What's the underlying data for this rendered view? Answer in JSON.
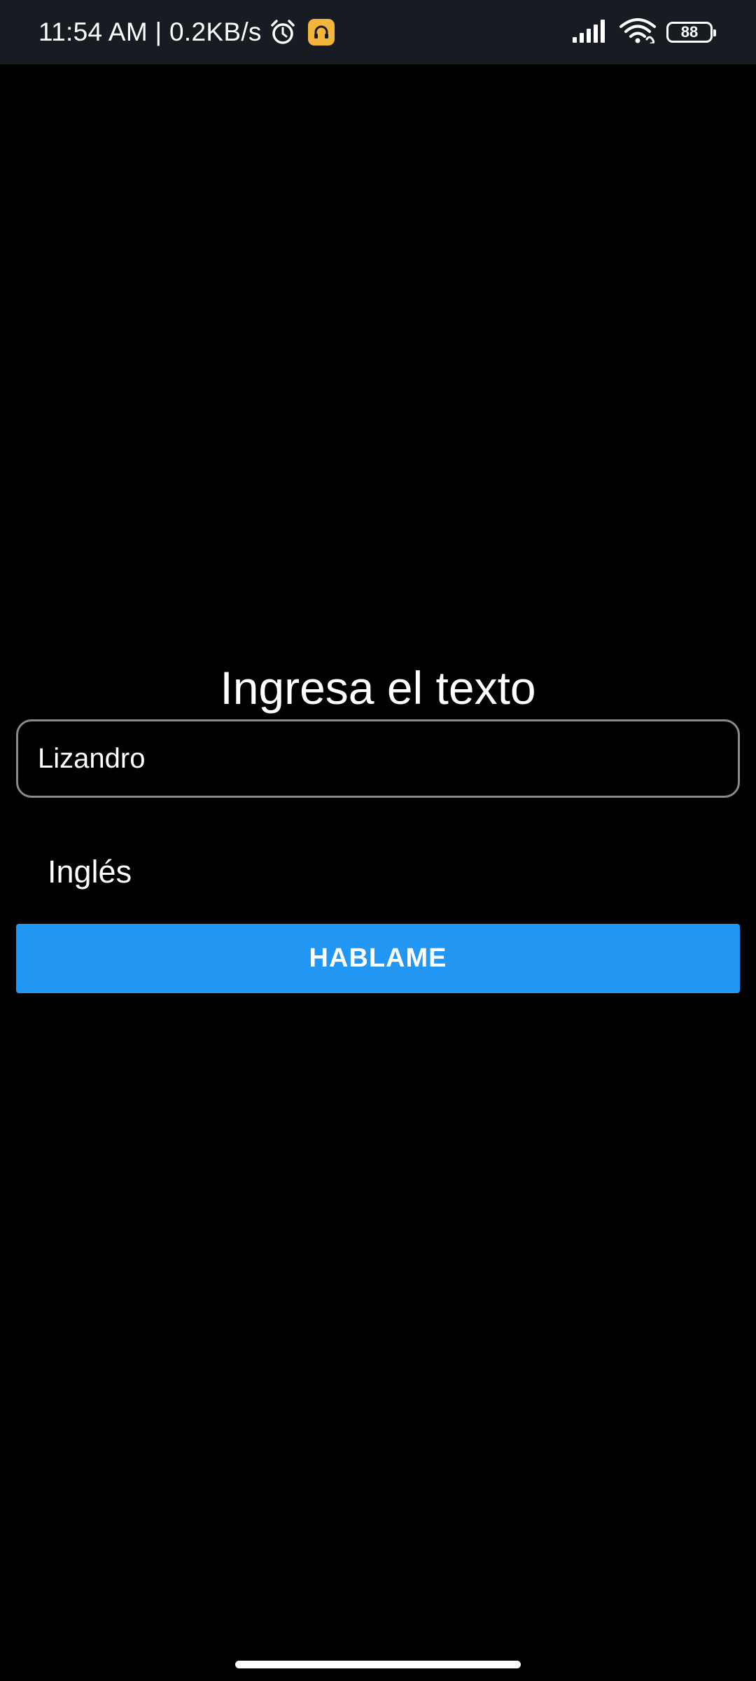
{
  "status_bar": {
    "time_and_speed": "11:54 AM | 0.2KB/s",
    "battery_level": "88",
    "icons": [
      "alarm-icon",
      "app-notification-icon",
      "signal-icon",
      "wifi-icon",
      "battery-icon"
    ]
  },
  "screen": {
    "title": "Ingresa el texto",
    "text_input_value": "Lizandro",
    "language_label": "Inglés",
    "speak_button_label": "HABLAME"
  },
  "colors": {
    "background": "#000000",
    "status_bar": "#171b22",
    "button": "#2196f3",
    "field_border": "#8a8a8a"
  }
}
